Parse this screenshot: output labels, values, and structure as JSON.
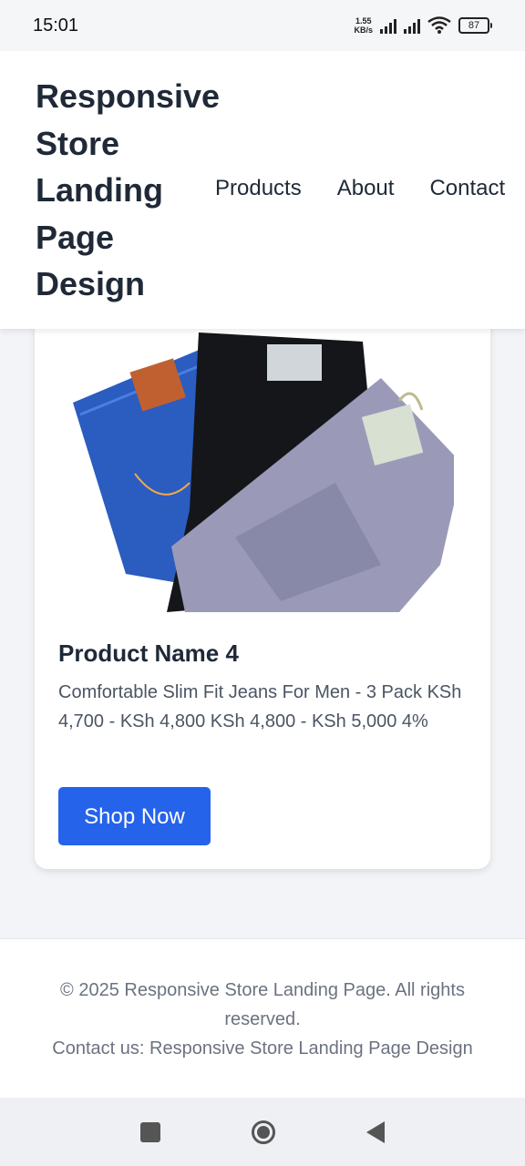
{
  "status_bar": {
    "time": "15:01",
    "net_speed_value": "1.55",
    "net_speed_unit": "KB/s",
    "battery": "87"
  },
  "header": {
    "title": "Responsive Store Landing Page Design",
    "nav": [
      "Products",
      "About",
      "Contact"
    ]
  },
  "product": {
    "name": "Product Name 4",
    "description": "Comfortable Slim Fit Jeans For Men - 3 Pack KSh 4,700 - KSh 4,800 KSh 4,800 - KSh 5,000 4%",
    "button_label": "Shop Now",
    "image_icon": "jeans-image"
  },
  "footer": {
    "copyright": "© 2025 Responsive Store Landing Page. All rights reserved.",
    "contact": "Contact us: Responsive Store Landing Page Design"
  },
  "colors": {
    "accent": "#2563eb",
    "page_bg": "#f2f4f7",
    "text_dark": "#1f2937",
    "text_muted": "#6b7280"
  }
}
